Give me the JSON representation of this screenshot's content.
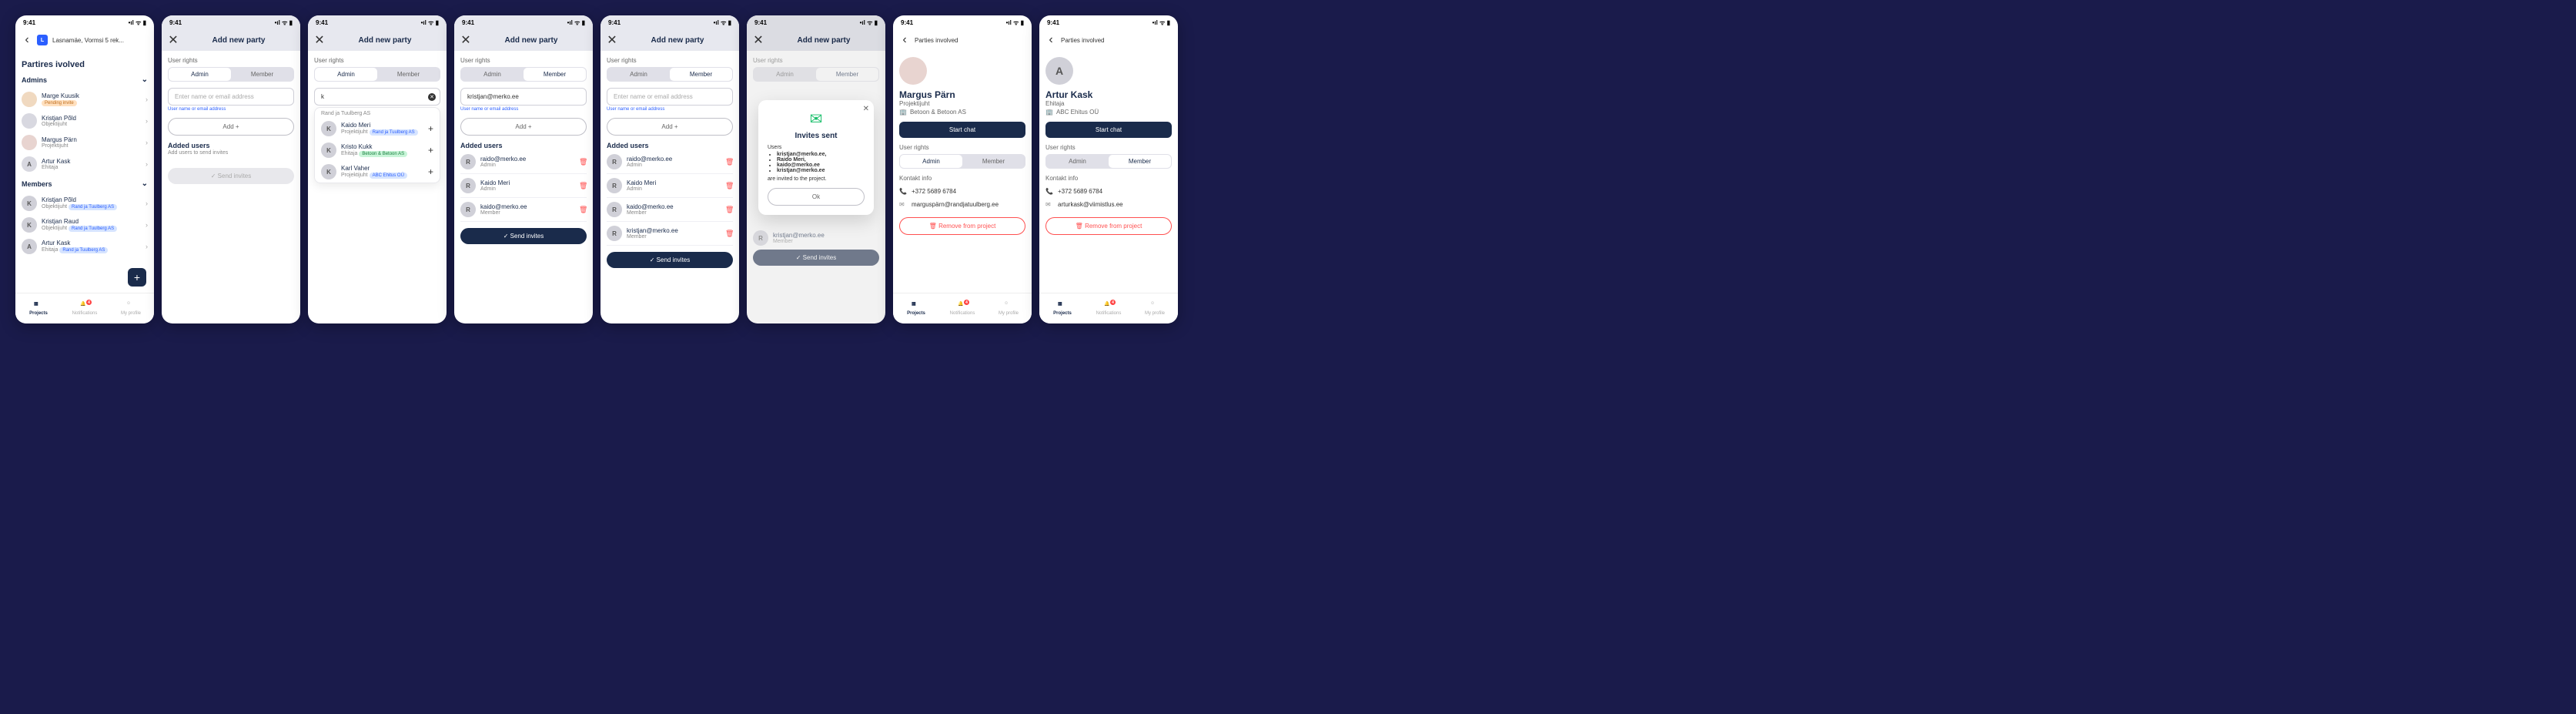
{
  "status": {
    "time": "9:41"
  },
  "breadcrumb": {
    "badge": "L",
    "text": "Lasnamäe, Vormsi 5 rek..."
  },
  "titles": {
    "parties_involved": "Partires ivolved",
    "add_new_party": "Add new party",
    "parties_back": "Parties involved"
  },
  "sections": {
    "admins": "Admins",
    "members": "Members",
    "added_users": "Added users"
  },
  "form": {
    "user_rights": "User rights",
    "admin": "Admin",
    "member": "Member",
    "placeholder": "Enter name or email address",
    "helper": "User name or email address",
    "add": "Add",
    "send_invites": "Send invites",
    "added_help": "Add users to send invites",
    "typed_k": "k",
    "typed_email": "kristjan@merko.ee"
  },
  "dd": {
    "group": "Rand ja Tuulberg AS",
    "items": [
      {
        "name": "Kaido Meri",
        "role": "Projektijuht",
        "comp": "Rand ja Tuulberg AS",
        "bcls": "blue"
      },
      {
        "name": "Kristo Kukk",
        "role": "Ehitaja",
        "comp": "Betoon & Betoon AS",
        "bcls": "green"
      },
      {
        "name": "Karl Vaher",
        "role": "Projektijuht",
        "comp": "ABC Ehitus OÜ",
        "bcls": "blue"
      }
    ]
  },
  "s1_admins": [
    {
      "name": "Marge Kuusik",
      "sub": "Pending invite",
      "badge": "orange",
      "av": "c1"
    },
    {
      "name": "Kristjan Põld",
      "sub": "Objektijuht",
      "av": "c3"
    },
    {
      "name": "Margus Pärn",
      "sub": "Projektijuht",
      "av": "c2"
    },
    {
      "name": "Artur Kask",
      "sub": "Ehitaja",
      "av": "c3",
      "letter": "A"
    }
  ],
  "s1_members": [
    {
      "name": "Kristjan Põld",
      "sub": "Objektijuht",
      "comp": "Rand ja Tuulberg AS",
      "letter": "K"
    },
    {
      "name": "Kristjan Raud",
      "sub": "Objektijuht",
      "comp": "Rand ja Tuulberg AS",
      "letter": "K"
    },
    {
      "name": "Artur Kask",
      "sub": "Ehitaja",
      "comp": "Rand ja Tuulberg AS",
      "letter": "A"
    }
  ],
  "added3": [
    {
      "email": "raido@merko.ee",
      "role": "Admin",
      "letter": "R"
    },
    {
      "email": "Kaido Meri",
      "role": "Admin",
      "letter": "R"
    },
    {
      "email": "kaido@merko.ee",
      "role": "Member",
      "letter": "R"
    }
  ],
  "added4": [
    {
      "email": "raido@merko.ee",
      "role": "Admin",
      "letter": "R"
    },
    {
      "email": "Kaido Meri",
      "role": "Admin",
      "letter": "R"
    },
    {
      "email": "kaido@merko.ee",
      "role": "Member",
      "letter": "R"
    },
    {
      "email": "kristjan@merko.ee",
      "role": "Member",
      "letter": "R"
    }
  ],
  "modal": {
    "title": "Invites sent",
    "users_label": "Users",
    "list": [
      "kristjan@merko.ee,",
      "Raido Meri,",
      "kaido@merko.ee",
      "kristjan@merko.ee"
    ],
    "footer": "are invited to the project.",
    "ok": "Ok"
  },
  "profile1": {
    "name": "Margus Pärn",
    "role": "Projektijuht",
    "comp": "Betoon & Betoon AS",
    "phone": "+372 5689 6784",
    "email": "marguspärn@randjatuulberg.ee"
  },
  "profile2": {
    "name": "Artur Kask",
    "role": "Ehitaja",
    "comp": "ABC Ehitus OÜ",
    "phone": "+372 5689 6784",
    "email": "arturkask@viimistlus.ee"
  },
  "profile_labels": {
    "start_chat": "Start chat",
    "user_rights": "User rights",
    "contact_info": "Kontakt info",
    "remove": "Remove from project"
  },
  "bnav": {
    "projects": "Projects",
    "notifications": "Notifications",
    "profile": "My profile",
    "count": "4"
  }
}
